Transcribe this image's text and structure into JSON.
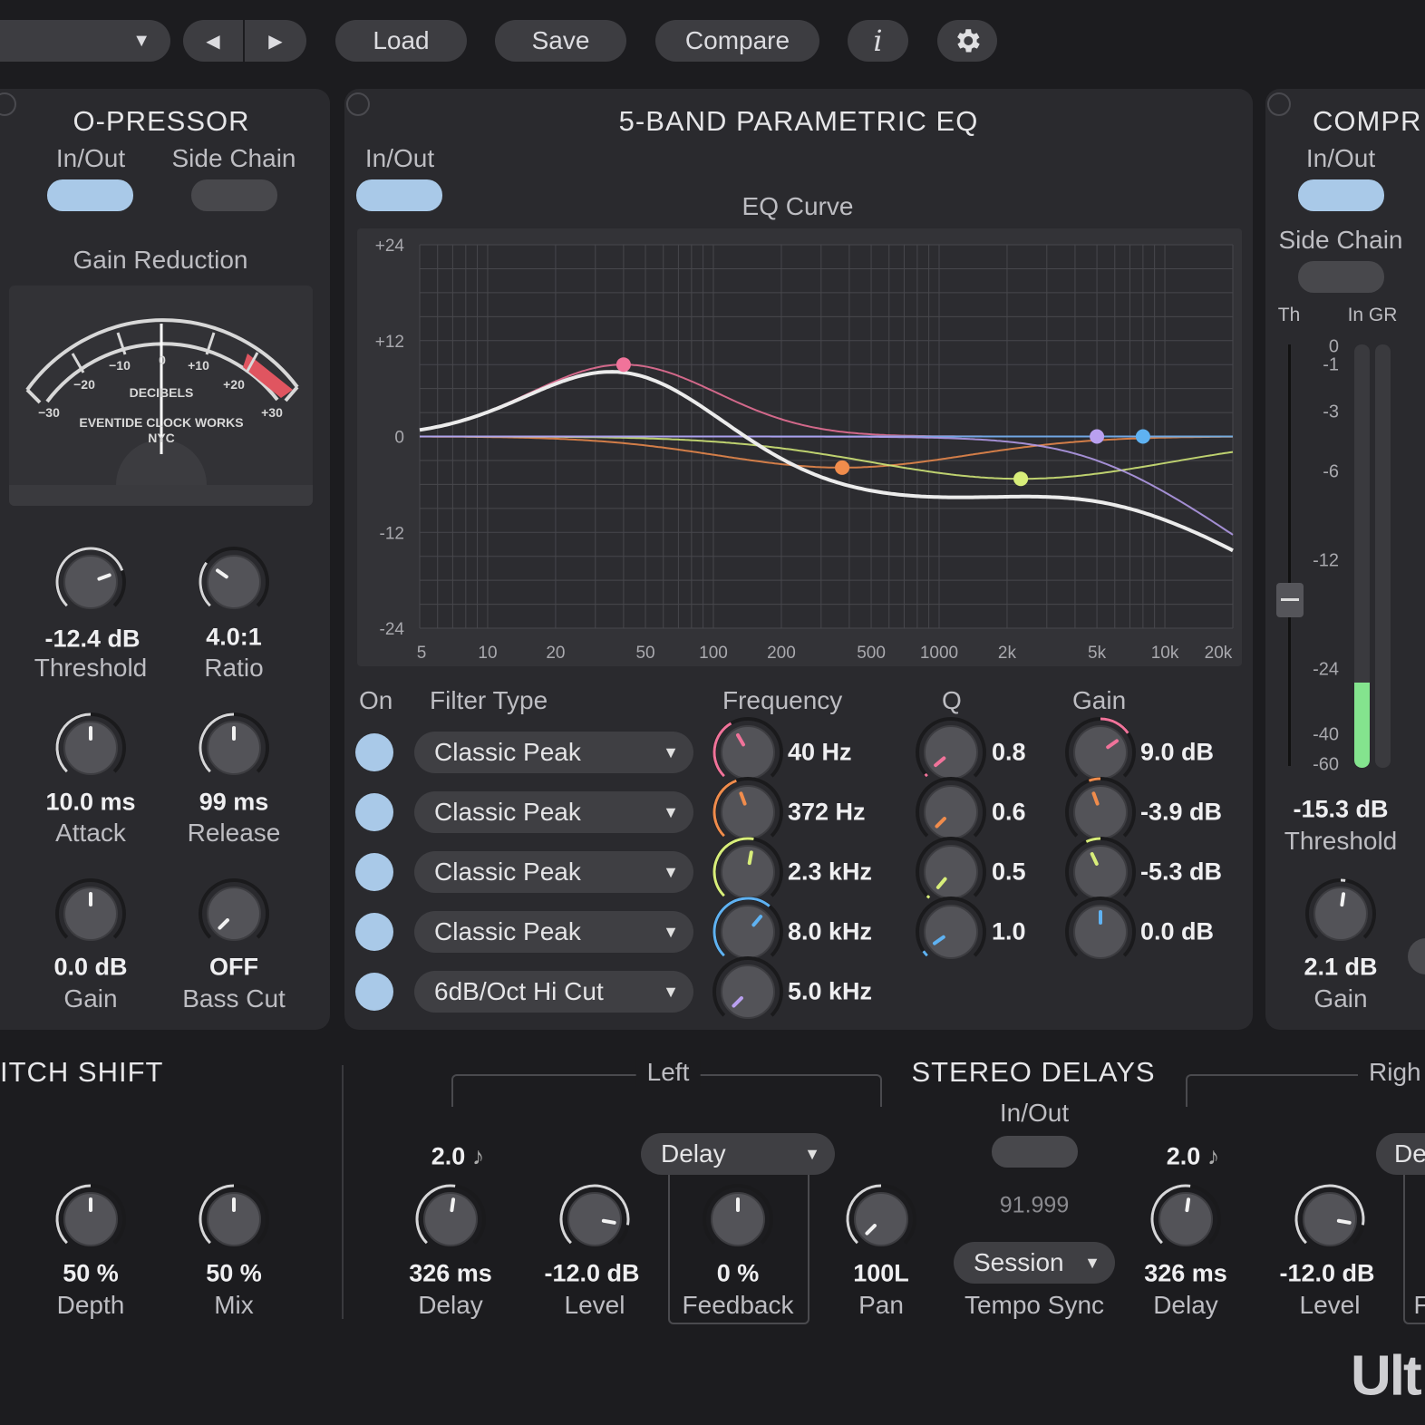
{
  "toolbar": {
    "preset_arrow": "▼",
    "prev": "◀",
    "next": "▶",
    "load": "Load",
    "save": "Save",
    "compare": "Compare",
    "info": "i",
    "settings_icon": "gear-icon"
  },
  "opressor": {
    "title": "O-PRESSOR",
    "inout": "In/Out",
    "sidechain": "Side Chain",
    "gain_reduction": "Gain Reduction",
    "meter": {
      "scale": [
        "−30",
        "−20",
        "−10",
        "0",
        "+10",
        "+20",
        "+30"
      ],
      "label1": "DECIBELS",
      "label2": "EVENTIDE CLOCK WORKS",
      "label3": "NYC"
    },
    "knobs": [
      {
        "value": "-12.4 dB",
        "label": "Threshold"
      },
      {
        "value": "4.0:1",
        "label": "Ratio"
      },
      {
        "value": "10.0 ms",
        "label": "Attack"
      },
      {
        "value": "99 ms",
        "label": "Release"
      },
      {
        "value": "0.0 dB",
        "label": "Gain"
      },
      {
        "value": "OFF",
        "label": "Bass Cut"
      }
    ]
  },
  "eq": {
    "title": "5-BAND PARAMETRIC EQ",
    "inout": "In/Out",
    "curve_title": "EQ Curve",
    "headers": {
      "on": "On",
      "type": "Filter Type",
      "freq": "Frequency",
      "q": "Q",
      "gain": "Gain"
    },
    "bands": [
      {
        "type": "Classic Peak",
        "freq": "40 Hz",
        "q": "0.8",
        "gain": "9.0 dB",
        "color": "#f0739a"
      },
      {
        "type": "Classic Peak",
        "freq": "372 Hz",
        "q": "0.6",
        "gain": "-3.9 dB",
        "color": "#f08c4c"
      },
      {
        "type": "Classic Peak",
        "freq": "2.3 kHz",
        "q": "0.5",
        "gain": "-5.3 dB",
        "color": "#d8ee7a"
      },
      {
        "type": "Classic Peak",
        "freq": "8.0 kHz",
        "q": "1.0",
        "gain": "0.0 dB",
        "color": "#5fb2f2"
      },
      {
        "type": "6dB/Oct Hi Cut",
        "freq": "5.0 kHz",
        "color": "#b9a0f0"
      }
    ],
    "dropdown_arrow": "▼"
  },
  "chart_data": {
    "type": "line",
    "title": "EQ Curve",
    "xscale": "log",
    "xlim": [
      5,
      20000
    ],
    "ylim": [
      -24,
      24
    ],
    "yticks": [
      "+24",
      "+12",
      "0",
      "-12",
      "-24"
    ],
    "xticks": [
      "5",
      "10",
      "20",
      "50",
      "100",
      "200",
      "500",
      "1000",
      "2k",
      "5k",
      "10k",
      "20k"
    ],
    "xtick_values": [
      5,
      10,
      20,
      50,
      100,
      200,
      500,
      1000,
      2000,
      5000,
      10000,
      20000
    ],
    "ytick_values": [
      24,
      12,
      0,
      -12,
      -24
    ],
    "bands": [
      {
        "freq": 40,
        "gain": 9,
        "q": 0.8
      },
      {
        "freq": 372,
        "gain": -3.9,
        "q": 0.6
      },
      {
        "freq": 2300,
        "gain": -5.3,
        "q": 0.5
      },
      {
        "freq": 8000,
        "gain": 0,
        "q": 1.0
      },
      {
        "freq": 5000,
        "gain": 0,
        "type": "hicut"
      }
    ]
  },
  "comp": {
    "title": "COMPR",
    "inout": "In/Out",
    "sidechain": "Side Chain",
    "th": "Th",
    "ingr": "In GR",
    "scale": [
      "0",
      "-1",
      "-3",
      "-6",
      "-12",
      "-24",
      "-40",
      "-60"
    ],
    "threshold_value": "-15.3 dB",
    "threshold_label": "Threshold",
    "gain_value": "2.1 dB",
    "gain_label": "Gain",
    "input_level_db": -27
  },
  "pitch": {
    "title": "ITCH SHIFT",
    "knobs": [
      {
        "value": "50 %",
        "label": "Depth"
      },
      {
        "value": "50 %",
        "label": "Mix"
      }
    ]
  },
  "delays": {
    "title": "STEREO DELAYS",
    "left": "Left",
    "right": "Righ",
    "inout": "In/Out",
    "bpm": "91.999",
    "sync": "Session",
    "sync_label": "Tempo Sync",
    "note": "2.0",
    "note_icon": "♪",
    "left_knobs": [
      {
        "value": "326 ms",
        "label": "Delay"
      },
      {
        "value": "-12.0 dB",
        "label": "Level"
      },
      {
        "value": "0 %",
        "label": "Feedback"
      },
      {
        "value": "100L",
        "label": "Pan"
      }
    ],
    "mode": "Delay",
    "right_mode": "De",
    "right_knobs": [
      {
        "value": "326 ms",
        "label": "Delay"
      },
      {
        "value": "-12.0 dB",
        "label": "Level"
      }
    ],
    "right_partial": "F"
  },
  "brand": "Ult"
}
